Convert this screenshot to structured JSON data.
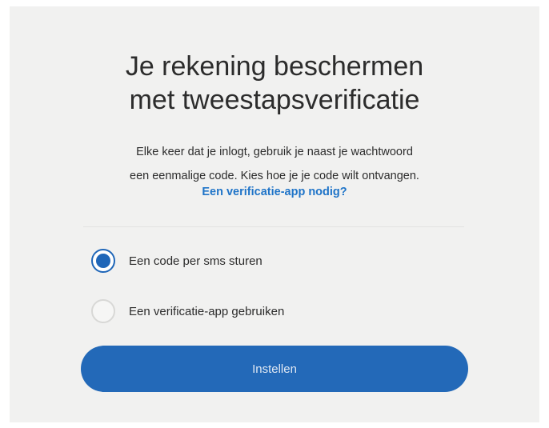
{
  "heading": {
    "line1": "Je rekening beschermen",
    "line2": "met tweestapsverificatie"
  },
  "description": {
    "line1": "Elke keer dat je inlogt, gebruik je naast je wachtwoord",
    "line2": "een eenmalige code. Kies hoe je je code wilt ontvangen."
  },
  "help_link": "Een verificatie-app nodig?",
  "options": [
    {
      "label": "Een code per sms sturen",
      "selected": true
    },
    {
      "label": "Een verificatie-app gebruiken",
      "selected": false
    }
  ],
  "submit_button": "Instellen",
  "colors": {
    "accent": "#2369b8",
    "link": "#1f74c8",
    "background": "#f1f1f0"
  }
}
